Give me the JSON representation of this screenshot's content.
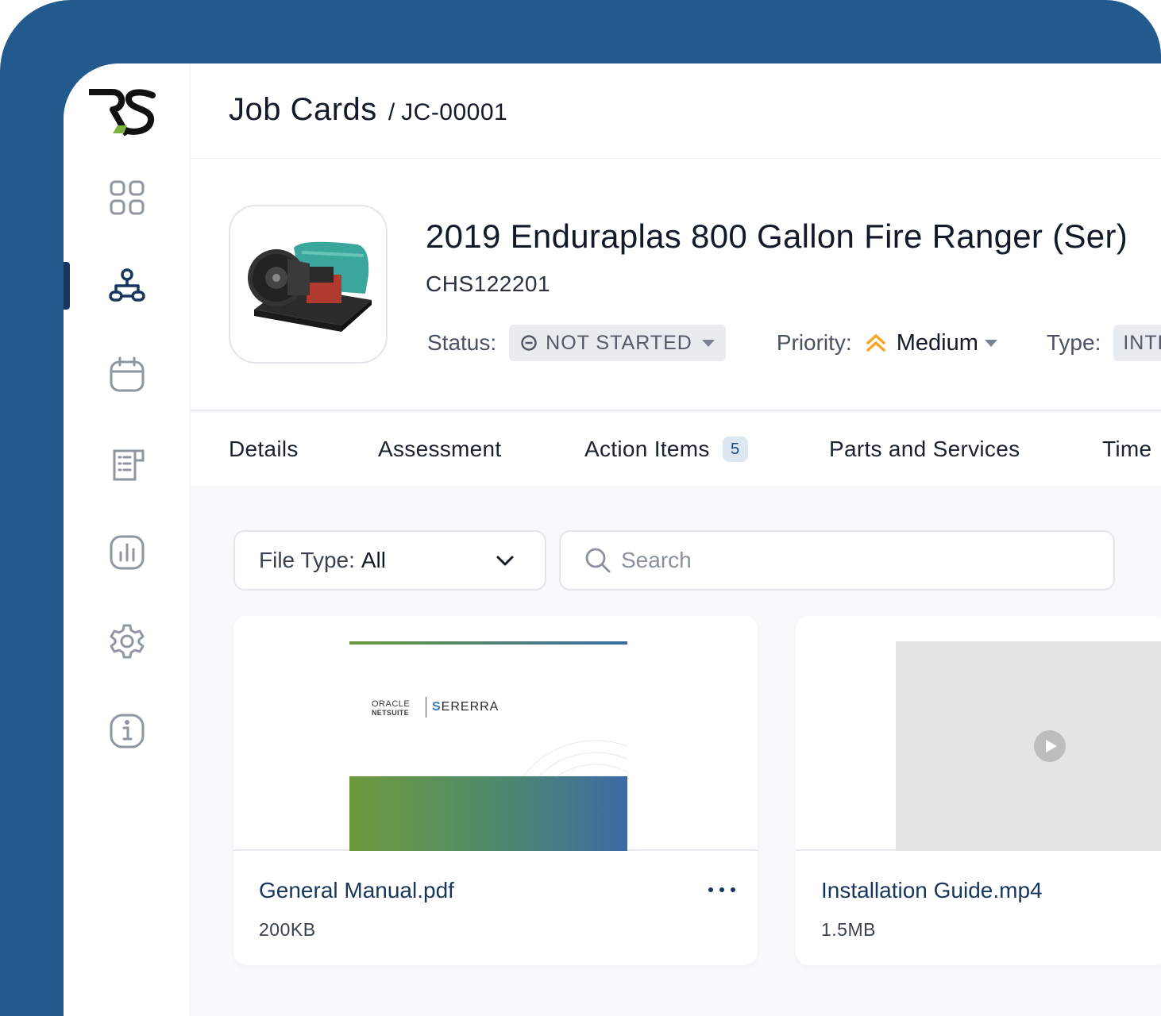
{
  "header": {
    "title": "Job Cards",
    "separator": "/",
    "job_id": "JC-00001"
  },
  "asset": {
    "title": "2019 Enduraplas 800 Gallon Fire Ranger (Ser)",
    "serial": "CHS122201",
    "status_label": "Status:",
    "status_value": "NOT STARTED",
    "priority_label": "Priority:",
    "priority_value": "Medium",
    "priority_color": "#f5a623",
    "type_label": "Type:",
    "type_value": "INTE"
  },
  "tabs": [
    {
      "label": "Details"
    },
    {
      "label": "Assessment"
    },
    {
      "label": "Action Items",
      "badge": "5"
    },
    {
      "label": "Parts and Services"
    },
    {
      "label": "Time"
    }
  ],
  "filters": {
    "file_type_label": "File Type:",
    "file_type_value": "All",
    "search_placeholder": "Search"
  },
  "files": [
    {
      "name": "General Manual.pdf",
      "size": "200KB",
      "preview": {
        "oracle_text": "ORACLE",
        "netsuite_text": "NETSUITE",
        "brand_initial": "S",
        "brand_rest": "ERERRA"
      }
    },
    {
      "name": "Installation Guide.mp4",
      "size": "1.5MB"
    }
  ],
  "sidebar": {
    "logo": "RS",
    "items": [
      {
        "icon": "dashboard-grid-icon"
      },
      {
        "icon": "org-hierarchy-icon",
        "active": true
      },
      {
        "icon": "calendar-icon"
      },
      {
        "icon": "document-list-icon"
      },
      {
        "icon": "bar-chart-icon"
      },
      {
        "icon": "gear-icon"
      },
      {
        "icon": "info-icon"
      }
    ]
  },
  "colors": {
    "brand_blue": "#225a8d",
    "navy": "#17365d",
    "logo_green": "#7cb342"
  }
}
